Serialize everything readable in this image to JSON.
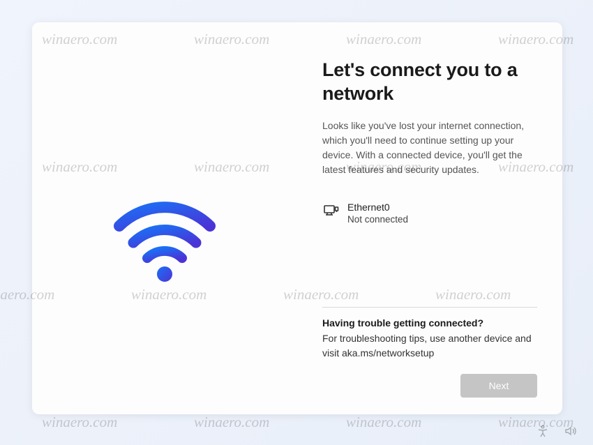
{
  "watermark": "winaero.com",
  "main": {
    "title": "Let's connect you to a network",
    "subtitle": "Looks like you've lost your internet connection, which you'll need to continue setting up your device. With a connected device, you'll get the latest features and security updates.",
    "network": {
      "name": "Ethernet0",
      "status": "Not connected"
    },
    "help": {
      "title": "Having trouble getting connected?",
      "body": "For troubleshooting tips, use another device and visit aka.ms/networksetup"
    }
  },
  "buttons": {
    "next": "Next"
  },
  "taskbar": {
    "accessibility_icon": "accessibility",
    "volume_icon": "volume"
  }
}
